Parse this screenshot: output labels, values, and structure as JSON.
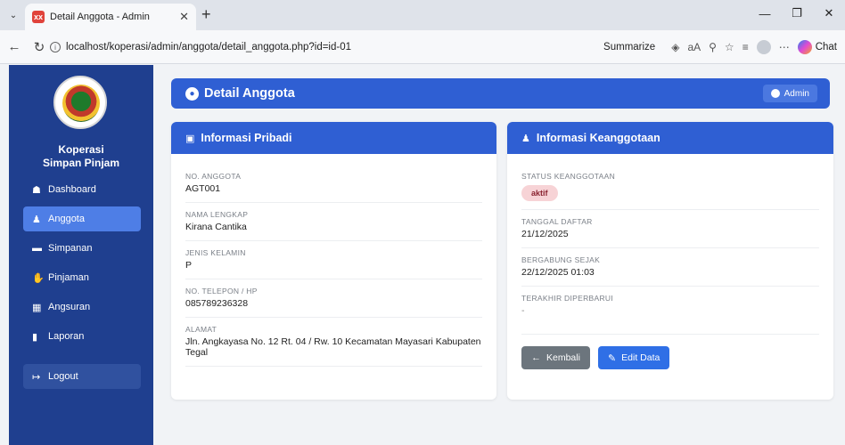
{
  "browser": {
    "tab_title": "Detail Anggota - Admin",
    "favicon_text": "xx",
    "url": "localhost/koperasi/admin/anggota/detail_anggota.php?id=id-01",
    "summarize_label": "Summarize",
    "chat_label": "Chat"
  },
  "sidebar": {
    "brand_line1": "Koperasi",
    "brand_line2": "Simpan Pinjam",
    "items": [
      {
        "label": "Dashboard",
        "icon": "home-icon"
      },
      {
        "label": "Anggota",
        "icon": "users-icon",
        "active": true
      },
      {
        "label": "Simpanan",
        "icon": "wallet-icon"
      },
      {
        "label": "Pinjaman",
        "icon": "hand-money-icon"
      },
      {
        "label": "Angsuran",
        "icon": "calendar-icon"
      },
      {
        "label": "Laporan",
        "icon": "file-icon"
      }
    ],
    "logout_label": "Logout"
  },
  "header": {
    "title": "Detail Anggota",
    "admin_label": "Admin"
  },
  "pribadi": {
    "title": "Informasi Pribadi",
    "fields": [
      {
        "label": "NO. ANGGOTA",
        "value": "AGT001"
      },
      {
        "label": "NAMA LENGKAP",
        "value": "Kirana Cantika"
      },
      {
        "label": "JENIS KELAMIN",
        "value": "P"
      },
      {
        "label": "NO. TELEPON / HP",
        "value": "085789236328"
      },
      {
        "label": "ALAMAT",
        "value": "Jln. Angkayasa No. 12 Rt. 04 / Rw. 10 Kecamatan Mayasari Kabupaten Tegal"
      }
    ]
  },
  "keanggotaan": {
    "title": "Informasi Keanggotaan",
    "status_label": "STATUS KEANGGOTAAN",
    "status_value": "aktif",
    "fields": [
      {
        "label": "TANGGAL DAFTAR",
        "value": "21/12/2025"
      },
      {
        "label": "BERGABUNG SEJAK",
        "value": "22/12/2025 01:03"
      },
      {
        "label": "TERAKHIR DIPERBARUI",
        "value": "-"
      }
    ],
    "back_label": "Kembali",
    "edit_label": "Edit Data"
  },
  "colors": {
    "sidebar": "#1f3f8f",
    "primary": "#2f5fd3",
    "active_menu": "#4e7ee6",
    "status_pill_bg": "#f7d3d6"
  }
}
